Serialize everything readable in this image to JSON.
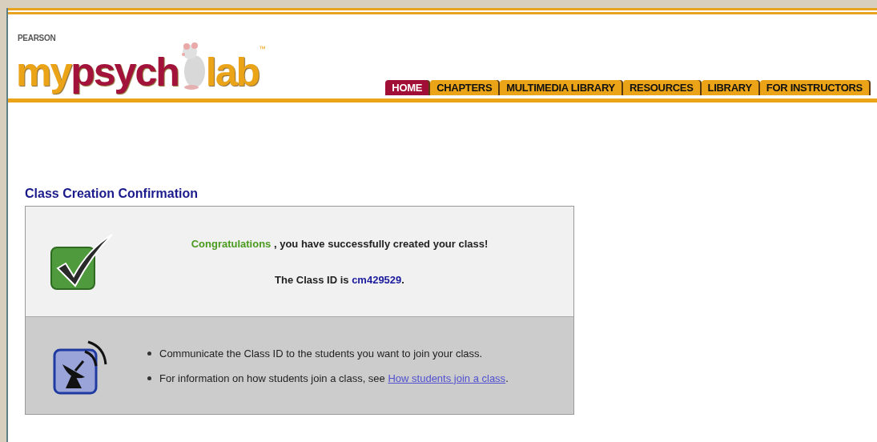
{
  "logo": {
    "brand": "PEARSON",
    "parts": [
      {
        "text": "my",
        "kind": "accent"
      },
      {
        "text": "psych",
        "kind": "main"
      },
      {
        "text": "lab",
        "kind": "accent"
      }
    ],
    "trademark": "™"
  },
  "tabs": [
    {
      "label": "HOME",
      "selected": true
    },
    {
      "label": "CHAPTERS",
      "selected": false
    },
    {
      "label": "MULTIMEDIA LIBRARY",
      "selected": false
    },
    {
      "label": "RESOURCES",
      "selected": false
    },
    {
      "label": "LIBRARY",
      "selected": false
    },
    {
      "label": "FOR INSTRUCTORS",
      "selected": false
    }
  ],
  "confirmation": {
    "title": "Class Creation Confirmation",
    "message": [
      {
        "text": "Congratulations",
        "kind": "success"
      },
      {
        "text": " , you have successfully created your class!",
        "kind": "plain"
      }
    ],
    "class_id": [
      {
        "text": "The Class ID is ",
        "kind": "plain"
      },
      {
        "text": "cm429529",
        "kind": "id"
      },
      {
        "text": ".",
        "kind": "plain"
      }
    ],
    "tips": [
      {
        "text": "Communicate the Class ID to the students you want to join your class."
      },
      {
        "text": "For information on how students join a class, see ",
        "link": "How students join a class",
        "after": "."
      }
    ]
  }
}
